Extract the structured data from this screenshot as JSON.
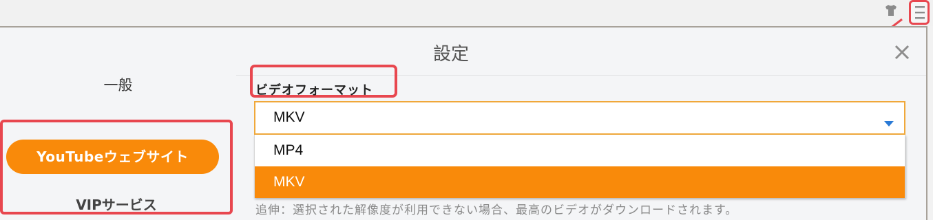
{
  "dialog": {
    "title": "設定"
  },
  "sidebar": {
    "items": [
      {
        "label": "一般"
      },
      {
        "label": "YouTubeウェブサイト"
      },
      {
        "label": "VIPサービス"
      }
    ]
  },
  "video_format": {
    "label": "ビデオフォーマット",
    "selected": "MKV",
    "options": [
      "MP4",
      "MKV"
    ],
    "highlighted_option": "MKV"
  },
  "note": "追伸：選択された解像度が利用できない場合、最高のビデオがダウンロードされます。",
  "icons": {
    "top_left": "shirt-icon",
    "top_right": "menu-icon",
    "close": "close-icon",
    "caret": "caret-down-icon"
  },
  "colors": {
    "accent": "#f98a0a",
    "annotation_red": "#e8474f",
    "select_border": "#f0a83a",
    "caret_blue": "#2a7ad6"
  }
}
